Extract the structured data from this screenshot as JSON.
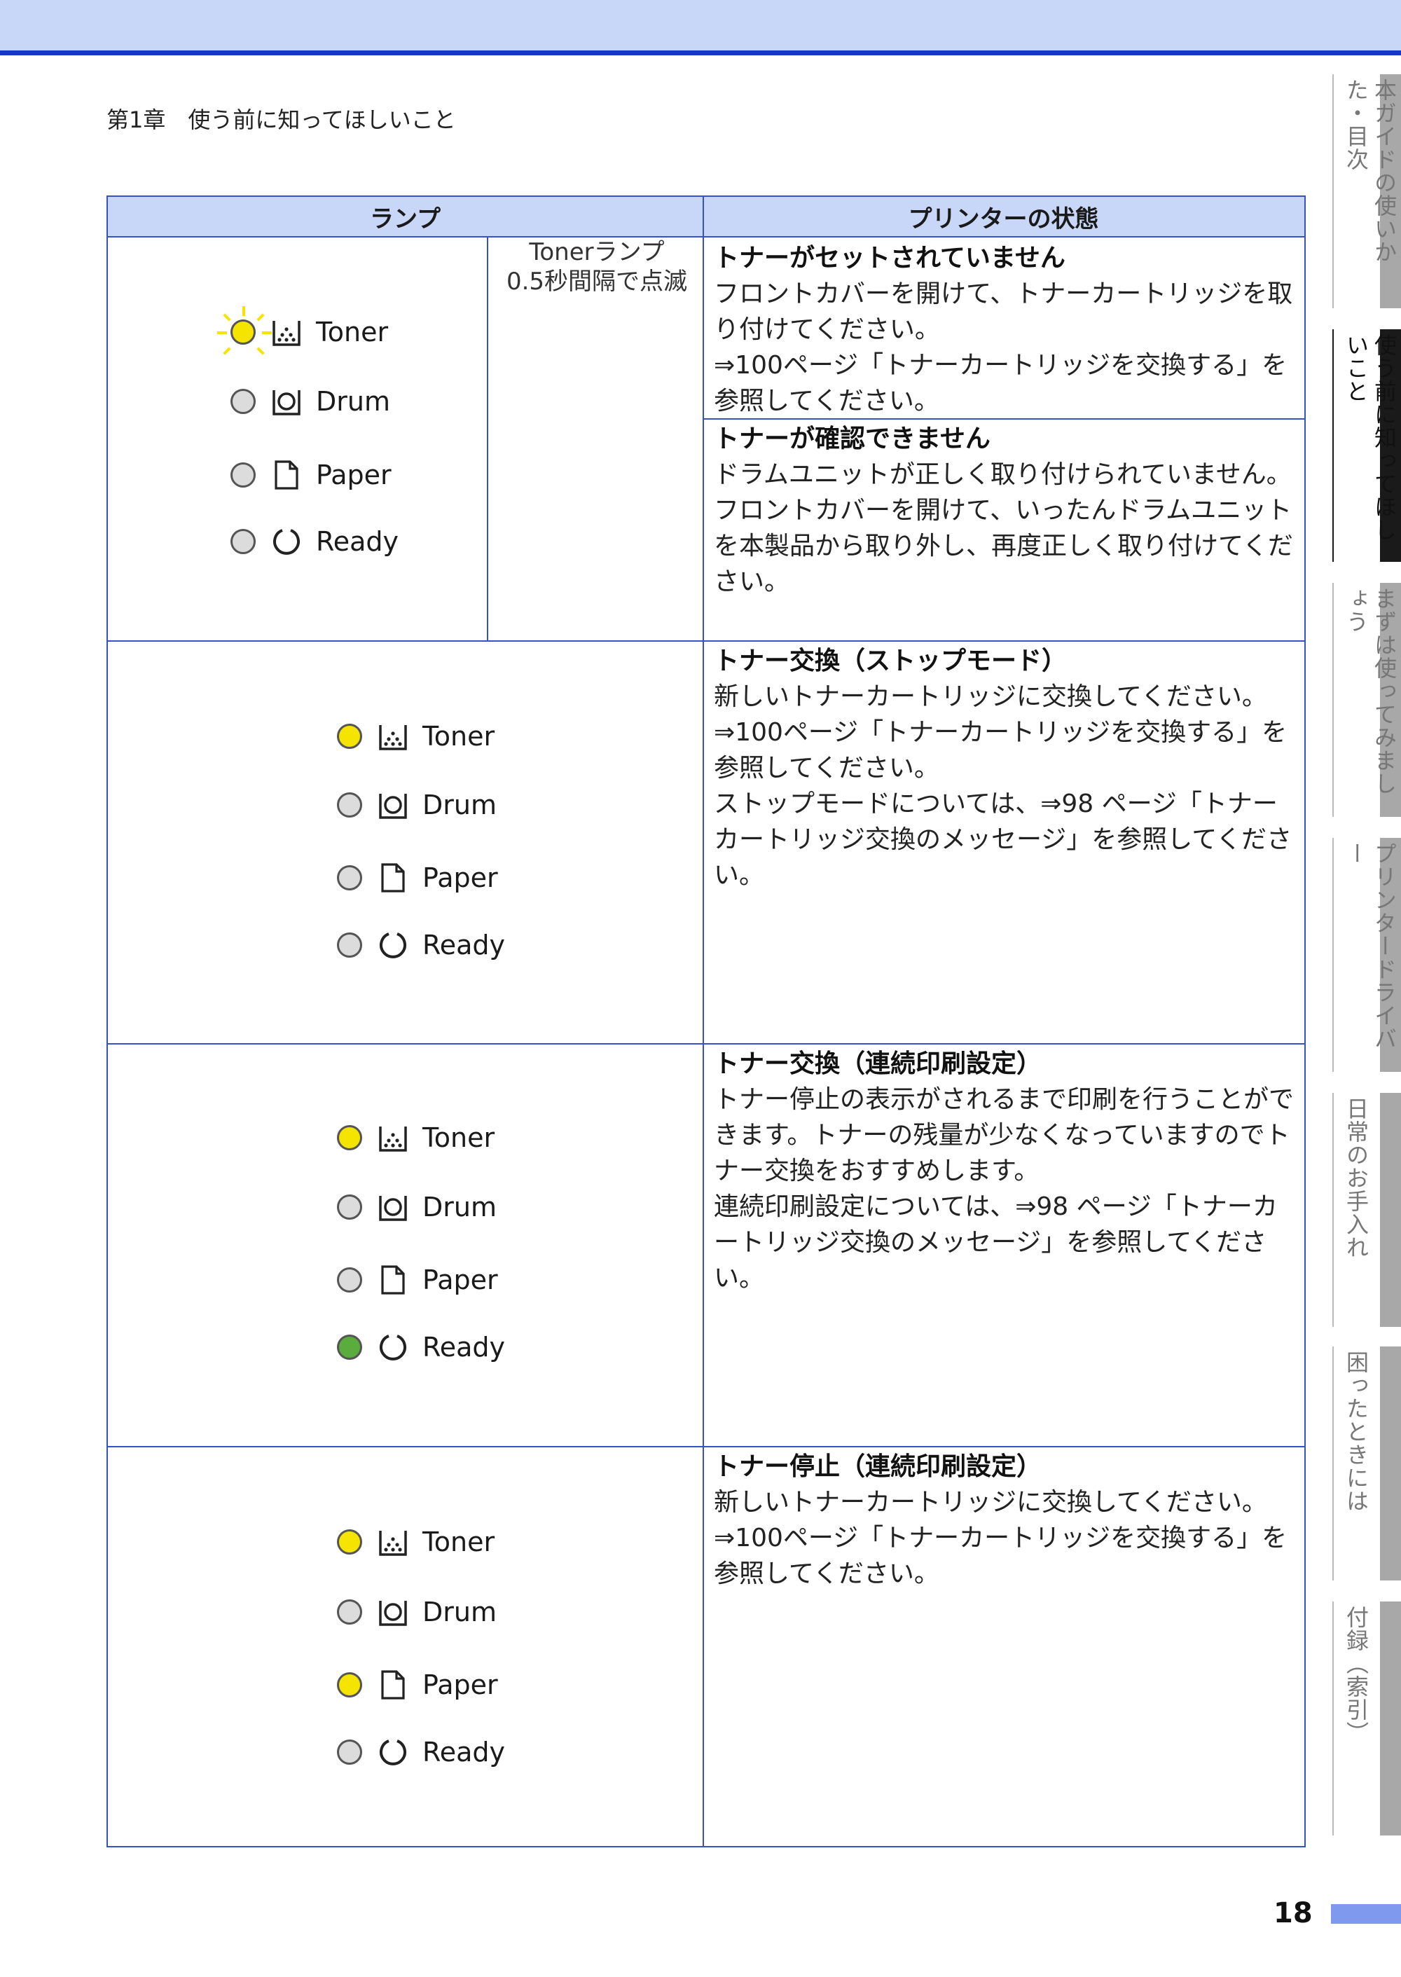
{
  "chapter": "第1章　使う前に知ってほしいこと",
  "table": {
    "header_lamp": "ランプ",
    "header_status": "プリンターの状態"
  },
  "lamp_labels": {
    "toner": "Toner",
    "drum": "Drum",
    "paper": "Paper",
    "ready": "Ready"
  },
  "row1": {
    "note": "Tonerランプ\n0.5秒間隔で点滅",
    "status_a_title": "トナーがセットされていません",
    "status_a_body": "フロントカバーを開けて、トナーカートリッジを取り付けてください。\n⇒100ページ「トナーカートリッジを交換する」を参照してください。",
    "status_b_title": "トナーが確認できません",
    "status_b_body": "ドラムユニットが正しく取り付けられていません。\nフロントカバーを開けて、いったんドラムユニットを本製品から取り外し、再度正しく取り付けてください。"
  },
  "row2": {
    "status_title": "トナー交換（ストップモード）",
    "status_body": "新しいトナーカートリッジに交換してください。\n⇒100ページ「トナーカートリッジを交換する」を参照してください。\nストップモードについては、⇒98 ページ「トナーカートリッジ交換のメッセージ」を参照してください。"
  },
  "row3": {
    "status_title": "トナー交換（連続印刷設定）",
    "status_body": "トナー停止の表示がされるまで印刷を行うことができます。トナーの残量が少なくなっていますのでトナー交換をおすすめします。\n連続印刷設定については、⇒98 ページ「トナーカートリッジ交換のメッセージ」を参照してください。"
  },
  "row4": {
    "status_title": "トナー停止（連続印刷設定）",
    "status_body": "新しいトナーカートリッジに交換してください。\n⇒100ページ「トナーカートリッジを交換する」を参照してください。"
  },
  "lamp_states": {
    "row1": {
      "toner": "blinking-yellow",
      "drum": "off",
      "paper": "off",
      "ready": "off"
    },
    "row2": {
      "toner": "yellow",
      "drum": "off",
      "paper": "off",
      "ready": "off"
    },
    "row3": {
      "toner": "yellow",
      "drum": "off",
      "paper": "off",
      "ready": "green"
    },
    "row4": {
      "toner": "yellow",
      "drum": "off",
      "paper": "yellow",
      "ready": "off"
    }
  },
  "colors": {
    "lamp_yellow": "#f5e400",
    "lamp_green": "#5aac3c",
    "lamp_off": "#dcdcdc",
    "accent": "#1538c4"
  },
  "side_tabs": [
    {
      "label": "本ガイドの使いかた・目次"
    },
    {
      "label": "使う前に知ってほしいこと",
      "active": true
    },
    {
      "label": "まずは使ってみましょう"
    },
    {
      "label": "プリンタードライバー"
    },
    {
      "label": "日常のお手入れ"
    },
    {
      "label": "困ったときには"
    },
    {
      "label": "付録（索引）"
    }
  ],
  "page_number": "18"
}
